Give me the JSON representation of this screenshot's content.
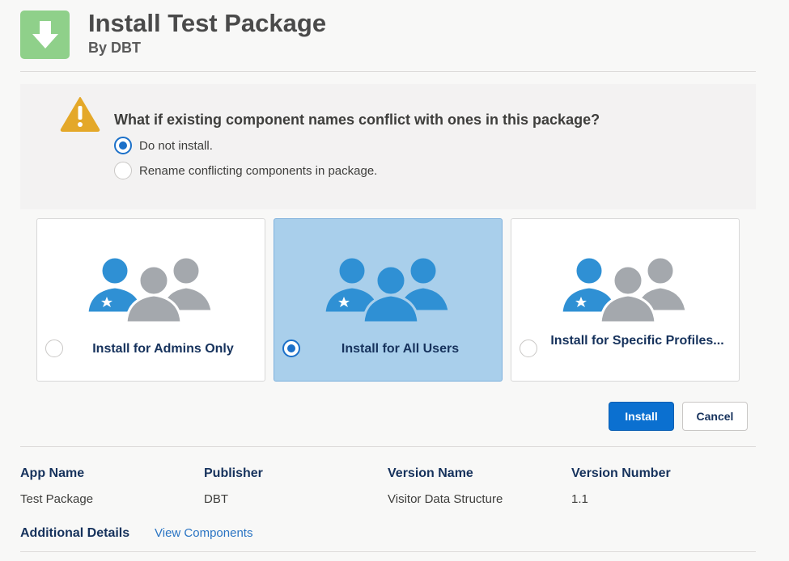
{
  "header": {
    "title": "Install Test Package",
    "subtitle": "By DBT",
    "icon": "download-arrow-icon"
  },
  "conflict": {
    "question": "What if existing component names conflict with ones in this package?",
    "icon": "warning-icon",
    "options": [
      {
        "label": "Do not install.",
        "selected": true
      },
      {
        "label": "Rename conflicting components in package.",
        "selected": false
      }
    ]
  },
  "install_options": [
    {
      "label": "Install for Admins Only",
      "selected": false,
      "icon": "admin-users-icon"
    },
    {
      "label": "Install for All Users",
      "selected": true,
      "icon": "all-users-icon"
    },
    {
      "label": "Install for Specific Profiles...",
      "selected": false,
      "icon": "profile-users-icon"
    }
  ],
  "buttons": {
    "install": "Install",
    "cancel": "Cancel"
  },
  "details": {
    "columns": [
      {
        "header": "App Name",
        "value": "Test Package"
      },
      {
        "header": "Publisher",
        "value": "DBT"
      },
      {
        "header": "Version Name",
        "value": "Visitor Data Structure"
      },
      {
        "header": "Version Number",
        "value": "1.1"
      }
    ],
    "additional_label": "Additional Details",
    "view_components": "View Components"
  },
  "colors": {
    "primary": "#0b70d0",
    "selected_card": "#a9cfeb",
    "icon_green": "#8fd08a",
    "warning": "#e4a829",
    "user_blue": "#2f90d4",
    "user_gray": "#a4a8ad"
  }
}
